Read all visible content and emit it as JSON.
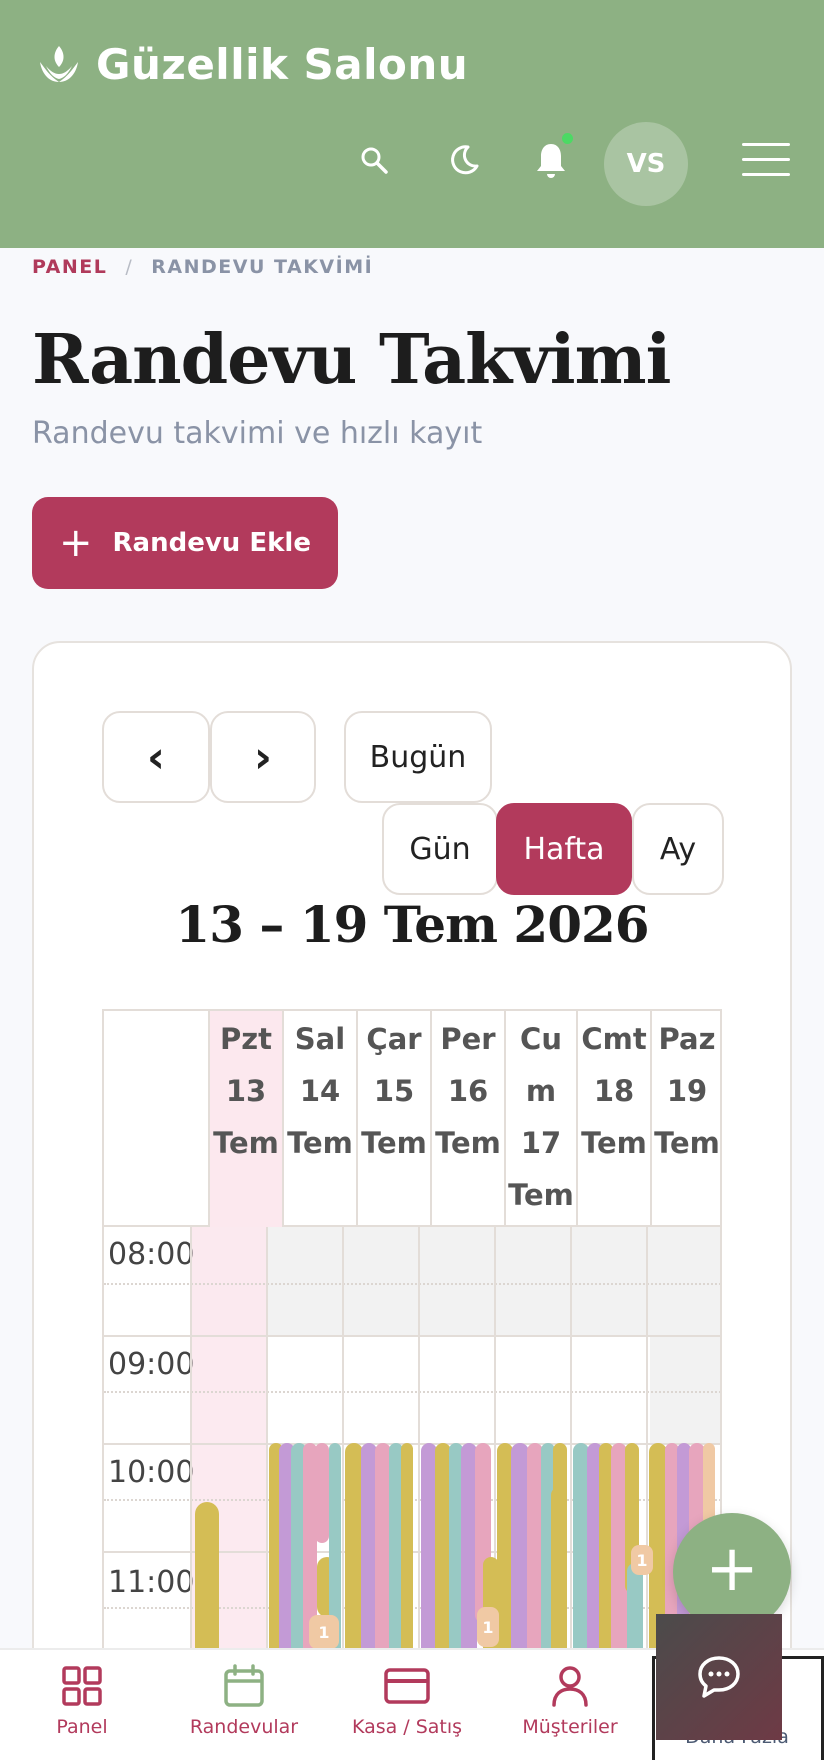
{
  "header": {
    "app_title": "Güzellik Salonu",
    "user_initials": "VS",
    "icons": [
      "search-icon",
      "moon-icon",
      "bell-icon",
      "menu-icon"
    ],
    "bg_color": "#8db183"
  },
  "breadcrumb": {
    "items": [
      "PANEL",
      "RANDEVU TAKVİMİ"
    ],
    "separator": "/"
  },
  "page": {
    "title": "Randevu Takvimi",
    "subtitle": "Randevu takvimi ve hızlı kayıt",
    "add_button_label": "Randevu Ekle",
    "accent_color": "#b23a5c"
  },
  "calendar": {
    "prev_label": "‹",
    "next_label": "›",
    "today_label": "Bugün",
    "views": [
      "Gün",
      "Hafta",
      "Ay"
    ],
    "active_view": "Hafta",
    "range_title": "13 – 19 Tem 2026",
    "days": [
      {
        "name": "Pzt",
        "date": "13",
        "month": "Tem",
        "today": true
      },
      {
        "name": "Sal",
        "date": "14",
        "month": "Tem"
      },
      {
        "name": "Çar",
        "date": "15",
        "month": "Tem"
      },
      {
        "name": "Per",
        "date": "16",
        "month": "Tem"
      },
      {
        "name": "Cu\nm",
        "date": "17",
        "month": "Tem"
      },
      {
        "name": "Cmt",
        "date": "18",
        "month": "Tem"
      },
      {
        "name": "Paz",
        "date": "19",
        "month": "Tem"
      }
    ],
    "times": [
      "08:00",
      "09:00",
      "10:00",
      "11:00"
    ],
    "event_chip_label": "1",
    "event_colors": [
      "#d4bd55",
      "#c39ad6",
      "#98c9c4",
      "#e7a5bd",
      "#f0c9a4"
    ]
  },
  "bottom_nav": {
    "items": [
      {
        "label": "Panel",
        "icon": "grid-icon"
      },
      {
        "label": "Randevular",
        "icon": "calendar-icon"
      },
      {
        "label": "Kasa / Satış",
        "icon": "card-icon"
      },
      {
        "label": "Müşteriler",
        "icon": "user-icon"
      },
      {
        "label": "Daha Fazla",
        "icon": "more-icon"
      }
    ]
  }
}
